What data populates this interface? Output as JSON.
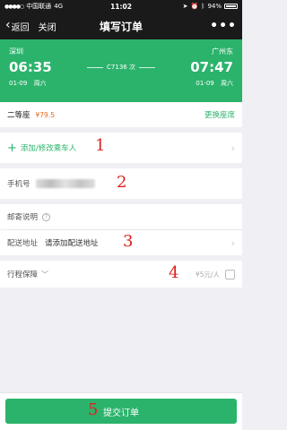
{
  "status_bar": {
    "carrier": "中国联通",
    "network": "4G",
    "time": "11:02",
    "battery": "94%"
  },
  "nav": {
    "back_label": "返回",
    "close_label": "关闭",
    "title": "填写订单",
    "more_label": "•••"
  },
  "train": {
    "from_station": "深圳",
    "to_station": "广州东",
    "depart_time": "06:35",
    "arrive_time": "07:47",
    "train_no": "C7136 次",
    "depart_date": "01-09",
    "depart_weekday": "周六",
    "arrive_date": "01-09",
    "arrive_weekday": "周六"
  },
  "seat": {
    "type": "二等座",
    "price": "¥79.5",
    "change_label": "更换座席"
  },
  "passenger": {
    "add_label": "添加/修改乘车人"
  },
  "phone": {
    "label": "手机号"
  },
  "mail": {
    "label": "邮寄说明",
    "info_icon": "?"
  },
  "address": {
    "label": "配送地址",
    "placeholder": "请添加配送地址"
  },
  "insurance": {
    "label": "行程保障",
    "price": "¥5元/人"
  },
  "footer": {
    "submit_label": "提交订单"
  },
  "annotations": [
    "1",
    "2",
    "3",
    "4",
    "5"
  ],
  "colors": {
    "accent": "#2bb36b",
    "price": "#e8671c",
    "annotation": "#e02020"
  }
}
